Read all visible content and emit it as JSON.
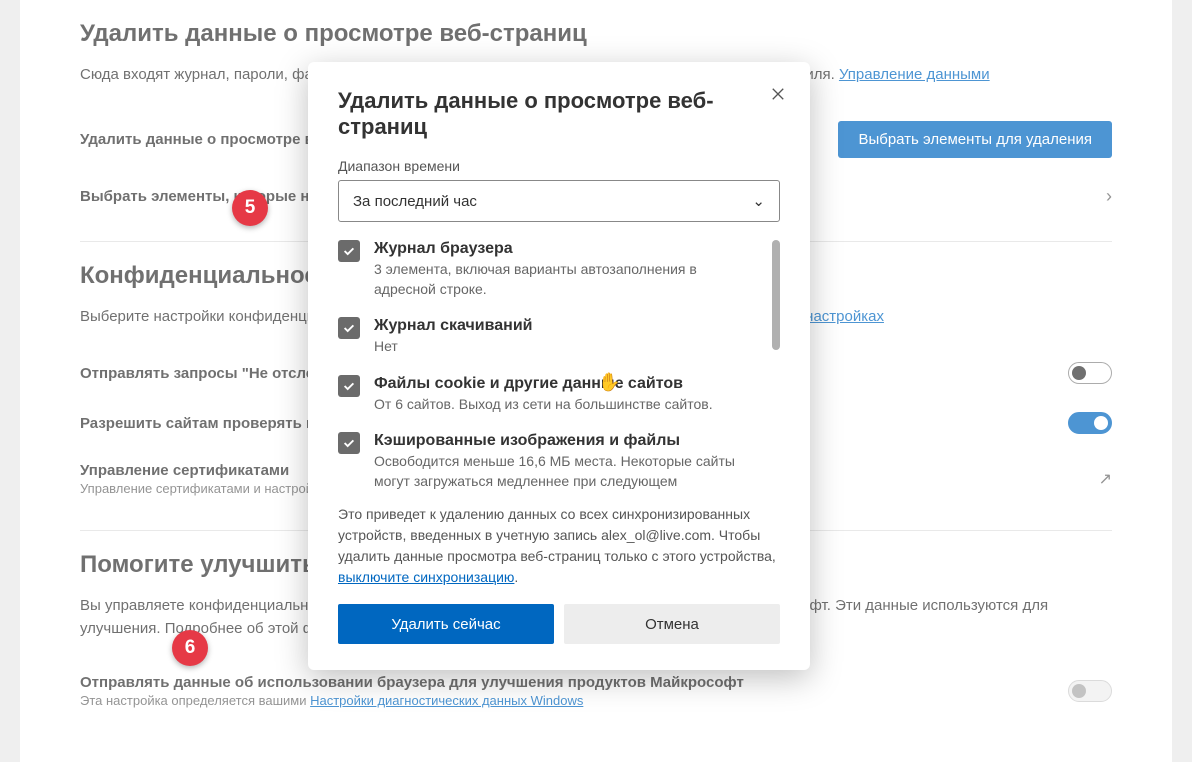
{
  "page": {
    "section1_title": "Удалить данные о просмотре веб-страниц",
    "section1_desc_prefix": "Сюда входят журнал, пароли, файлы cookie и многое другое. Будут удалены только данные этого профиля. ",
    "manage_data_link": "Управление данными",
    "row_delete_now_label": "Удалить данные о просмотре веб-страниц",
    "btn_choose": "Выбрать элементы для удаления",
    "row_choose_on_close": "Выбрать элементы, которые необходимо удалять каждый раз, когда вы закрываете браузер",
    "section2_title": "Конфиденциальность",
    "section2_desc_prefix": "Выберите настройки конфиденциальности для браузера. Подробнее об этих действиях можно найти в ",
    "settings_link": "настройках",
    "row_dnt": "Отправлять запросы \"Не отслеживать\"",
    "row_allow_sites": "Разрешить сайтам проверять наличие сохраненных способов оплаты",
    "row_cert": "Управление сертификатами",
    "row_cert_sub": "Управление сертификатами и настройками HTTPS/SSL",
    "section3_title": "Помогите улучшить",
    "section3_desc_prefix": "Вы управляете конфиденциальностью и помогаете развивать продукты, которые создаются в Майкрософт. Эти данные используются для улучшения. Подробнее об этой функции можно найти в ",
    "row_send_data": "Отправлять данные об использовании браузера для улучшения продуктов Майкрософт",
    "row_send_data_sub": "Эта настройка определяется вашими ",
    "diag_link": "Настройки диагностических данных Windows"
  },
  "dialog": {
    "title": "Удалить данные о просмотре веб-страниц",
    "time_range_label": "Диапазон времени",
    "time_range_value": "За последний час",
    "items": [
      {
        "title": "Журнал браузера",
        "desc": "3 элемента, включая варианты автозаполнения в адресной строке."
      },
      {
        "title": "Журнал скачиваний",
        "desc": "Нет"
      },
      {
        "title": "Файлы cookie и другие данные сайтов",
        "desc": "От 6 сайтов. Выход из сети на большинстве сайтов."
      },
      {
        "title": "Кэшированные изображения и файлы",
        "desc": "Освободится меньше 16,6 МБ места. Некоторые сайты могут загружаться медленнее при следующем"
      }
    ],
    "sync_note_prefix": "Это приведет к удалению данных со всех синхронизированных устройств, введенных в учетную запись alex_ol@live.com. Чтобы удалить данные просмотра веб-страниц только с этого устройства, ",
    "sync_link": "выключите синхронизацию",
    "btn_delete": "Удалить сейчас",
    "btn_cancel": "Отмена"
  },
  "annotations": {
    "badge5": "5",
    "badge6": "6"
  }
}
